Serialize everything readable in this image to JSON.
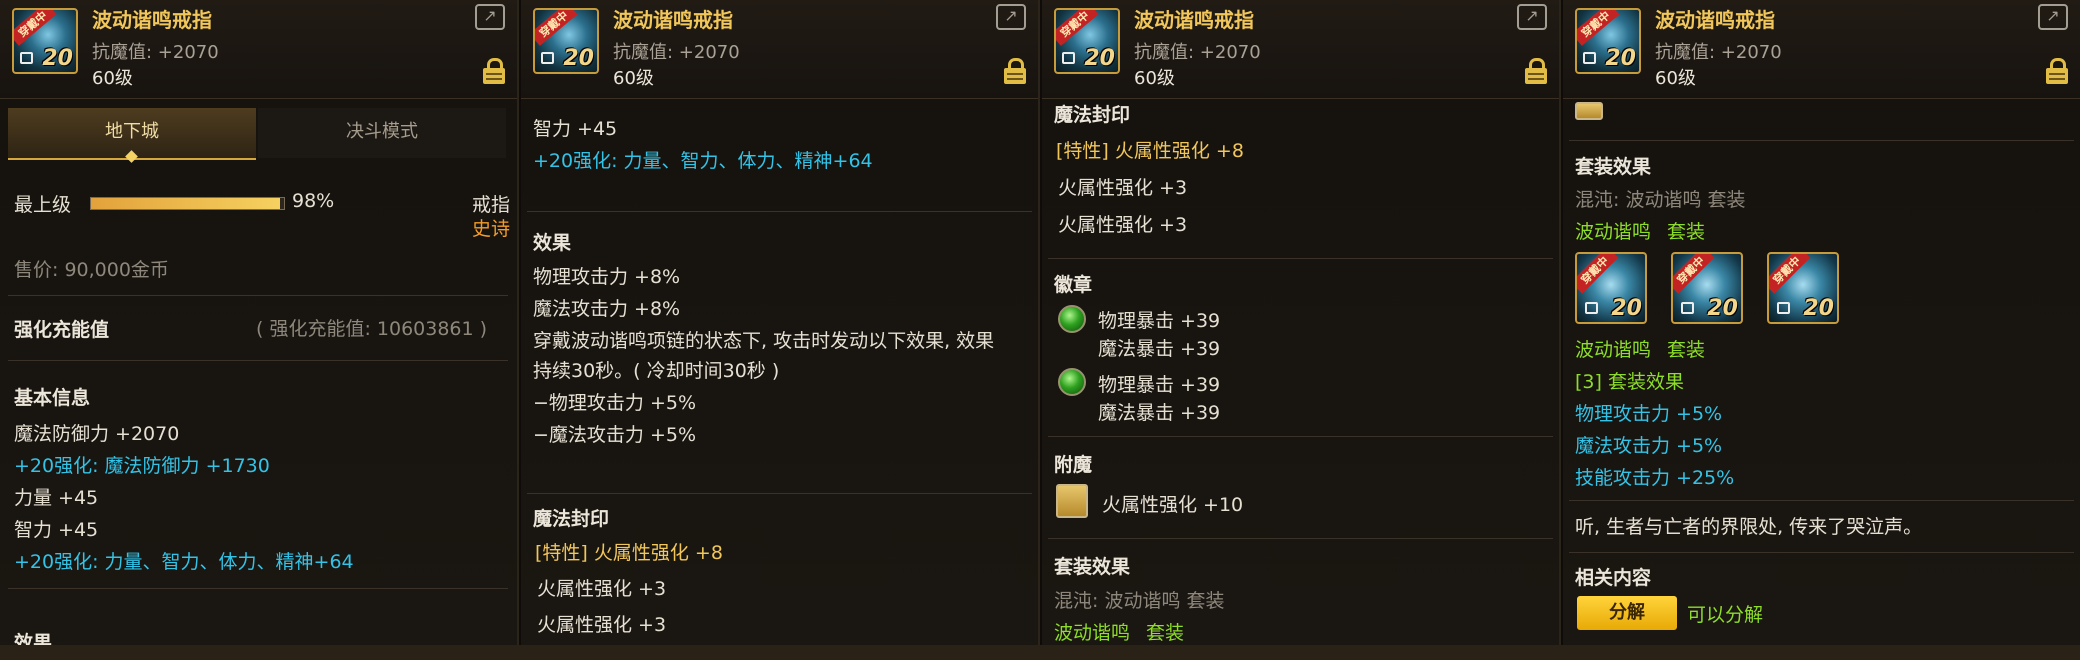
{
  "item": {
    "name": "波动谐鸣戒指",
    "stat": "抗魔值: +2070",
    "level": "60级",
    "badge": "穿戴中",
    "icon_level": "20"
  },
  "tabs": [
    "地下城",
    "决斗模式"
  ],
  "panel1": {
    "grade_label": "最上级",
    "grade_value": "98%",
    "grade_fraction": 0.98,
    "item_type": "戒指",
    "rarity": "史诗",
    "price": "售价: 90,000金币",
    "enhance_label": "强化充能值",
    "enhance_value": "( 强化充能值: 10603861 )",
    "basic_title": "基本信息",
    "lines": [
      "魔法防御力 +2070",
      "+20强化: 魔法防御力 +1730",
      "力量 +45",
      "智力 +45",
      "+20强化: 力量、智力、体力、精神+64"
    ],
    "effect_title_cut": "效果"
  },
  "panel2": {
    "lines_top": [
      "智力 +45",
      "+20强化: 力量、智力、体力、精神+64"
    ],
    "effect_title": "效果",
    "effect_lines": [
      "物理攻击力 +8%",
      "魔法攻击力 +8%",
      "穿戴波动谐鸣项链的状态下, 攻击时发动以下效果, 效果",
      "持续30秒。( 冷却时间30秒 )",
      "−物理攻击力 +5%",
      "−魔法攻击力 +5%"
    ],
    "seal_title": "魔法封印",
    "seal_lines": [
      "[特性] 火属性强化 +8",
      "火属性强化 +3",
      "火属性强化 +3"
    ]
  },
  "panel3": {
    "seal_title_cut": "魔法封印",
    "seal_lines": [
      "[特性] 火属性强化 +8",
      "火属性强化 +3",
      "火属性强化 +3"
    ],
    "emblem_title": "徽章",
    "emblems": [
      [
        "物理暴击 +39",
        "魔法暴击 +39"
      ],
      [
        "物理暴击 +39",
        "魔法暴击 +39"
      ]
    ],
    "enchant_title": "附魔",
    "enchant_value": "火属性强化 +10",
    "set_title": "套装效果",
    "set_type": "混沌: 波动谐鸣 套装",
    "set_name": "波动谐鸣",
    "set_suffix": "套装"
  },
  "panel4": {
    "set_title": "套装效果",
    "set_type": "混沌: 波动谐鸣 套装",
    "set_name": "波动谐鸣",
    "set_suffix": "套装",
    "set_name2": "波动谐鸣",
    "set_suffix2": "套装",
    "bonus_title": "[3] 套装效果",
    "bonus_lines": [
      "物理攻击力 +5%",
      "魔法攻击力 +5%",
      "技能攻击力 +25%"
    ],
    "flavor": "听, 生者与亡者的界限处, 传来了哭泣声。",
    "related_title": "相关内容",
    "disassemble_button": "分解",
    "disassemble_note": "可以分解"
  }
}
